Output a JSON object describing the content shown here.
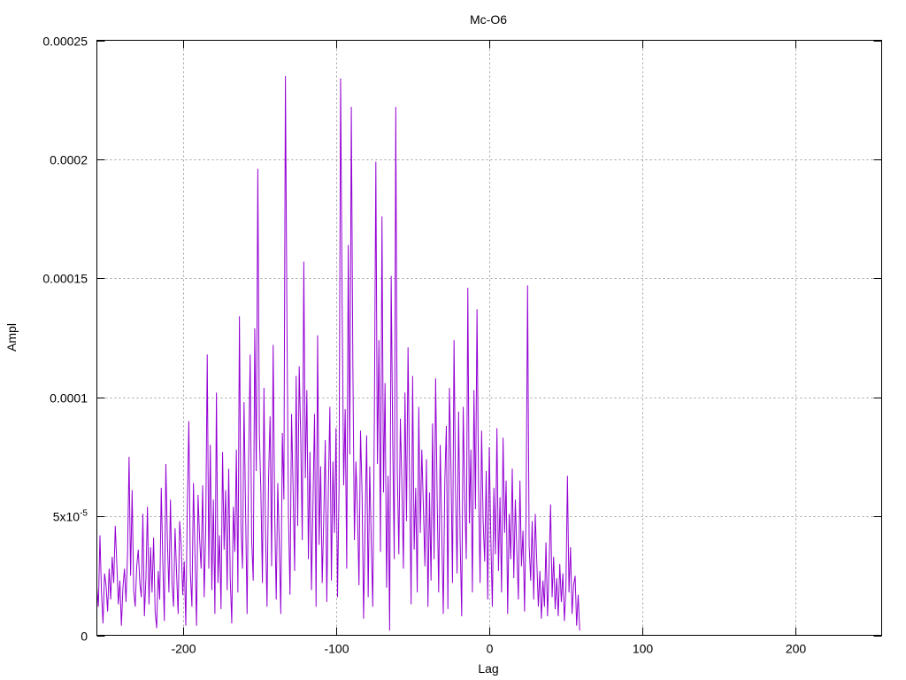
{
  "chart_data": {
    "type": "line",
    "title": "Mc-O6",
    "xlabel": "Lag",
    "ylabel": "Ampl",
    "xlim": [
      -256,
      256
    ],
    "ylim": [
      0,
      0.00025
    ],
    "grid": true,
    "x_ticks": [
      {
        "value": -200,
        "label": "-200"
      },
      {
        "value": -100,
        "label": "-100"
      },
      {
        "value": 0,
        "label": "0"
      },
      {
        "value": 100,
        "label": "100"
      },
      {
        "value": 200,
        "label": "200"
      }
    ],
    "y_ticks": [
      {
        "value": 0,
        "label": "0"
      },
      {
        "value": 5e-05,
        "label": "5x10",
        "sup": "-5"
      },
      {
        "value": 0.0001,
        "label": "0.0001"
      },
      {
        "value": 0.00015,
        "label": "0.00015"
      },
      {
        "value": 0.0002,
        "label": "0.0002"
      },
      {
        "value": 0.00025,
        "label": "0.00025"
      }
    ],
    "series": [
      {
        "color": "#9400d3",
        "x_start": -256,
        "x_step": 1,
        "values": [
          2e-05,
          1.2e-05,
          4.2e-05,
          1.8e-05,
          5e-06,
          2.6e-05,
          2.1e-05,
          1e-05,
          2.8e-05,
          1.5e-05,
          3.3e-05,
          2.2e-05,
          4.6e-05,
          3e-05,
          1.3e-05,
          2.3e-05,
          4e-06,
          2e-05,
          2.8e-05,
          1.4e-05,
          3.4e-05,
          7.5e-05,
          2.5e-05,
          6.1e-05,
          1.9e-05,
          1.2e-05,
          2.9e-05,
          3.6e-05,
          2.2e-05,
          1.6e-05,
          5.1e-05,
          8e-06,
          2.4e-05,
          5.4e-05,
          1.3e-05,
          3.7e-05,
          1.8e-05,
          4.1e-05,
          1e-05,
          3e-06,
          2.7e-05,
          1.5e-05,
          6.2e-05,
          3.1e-05,
          6e-06,
          7.2e-05,
          4e-05,
          1.8e-05,
          5.7e-05,
          2.2e-05,
          1.2e-05,
          4.5e-05,
          2.6e-05,
          9e-06,
          4.8e-05,
          3.8e-05,
          1.7e-05,
          3.1e-05,
          4e-06,
          5.4e-05,
          9e-05,
          2.6e-05,
          1.2e-05,
          6.4e-05,
          3.4e-05,
          4e-06,
          5.9e-05,
          4.1e-05,
          2.8e-05,
          6.3e-05,
          1.6e-05,
          4.4e-05,
          0.000118,
          2.8e-05,
          8e-05,
          1.9e-05,
          5.7e-05,
          9e-06,
          0.000102,
          2.2e-05,
          4.2e-05,
          1.1e-05,
          7.7e-05,
          3.6e-05,
          6.1e-05,
          1.9e-05,
          7e-05,
          2.4e-05,
          5e-06,
          5.4e-05,
          3.5e-05,
          7.8e-05,
          1.8e-05,
          0.000134,
          4.6e-05,
          2.8e-05,
          9.8e-05,
          5.3e-05,
          9e-06,
          7.3e-05,
          0.000118,
          4e-05,
          2.3e-05,
          0.000129,
          6.9e-05,
          0.000196,
          8.5e-05,
          6e-05,
          2.2e-05,
          0.000104,
          4.4e-05,
          1.2e-05,
          6.6e-05,
          9.2e-05,
          2.9e-05,
          0.000122,
          5.2e-05,
          1.5e-05,
          6.4e-05,
          3.8e-05,
          9e-06,
          8.5e-05,
          5.7e-05,
          0.000235,
          0.000131,
          5e-05,
          1.7e-05,
          9.3e-05,
          6.2e-05,
          2.7e-05,
          0.000109,
          4.6e-05,
          0.000113,
          8.3e-05,
          4e-05,
          0.000157,
          6.6e-05,
          0.000103,
          3.2e-05,
          7.7e-05,
          1.9e-05,
          5.6e-05,
          9.3e-05,
          1.2e-05,
          0.000126,
          3.8e-05,
          7.1e-05,
          2.2e-05,
          4.9e-05,
          8.2e-05,
          1.4e-05,
          6.1e-05,
          9.6e-05,
          2.3e-05,
          7.3e-05,
          4.3e-05,
          8.7e-05,
          1.6e-05,
          6.2e-05,
          0.000234,
          0.000141,
          6.3e-05,
          9.5e-05,
          2.8e-05,
          0.000164,
          7.6e-05,
          0.000222,
          0.000114,
          4e-05,
          7.3e-05,
          5.2e-05,
          2.1e-05,
          8.6e-05,
          6e-05,
          7e-06,
          4.7e-05,
          8.4e-05,
          1.6e-05,
          7.1e-05,
          3.9e-05,
          1.2e-05,
          8.8e-05,
          0.000199,
          7.2e-05,
          0.000124,
          3.5e-05,
          0.000176,
          6e-05,
          0.000106,
          2e-05,
          6.7e-05,
          2e-06,
          0.000151,
          8.2e-05,
          3.2e-05,
          0.000222,
          6.9e-05,
          3.4e-05,
          9.1e-05,
          6.3e-05,
          2.8e-05,
          0.000102,
          4.8e-05,
          0.000121,
          6.7e-05,
          1.3e-05,
          0.000109,
          3.6e-05,
          6.2e-05,
          1.8e-05,
          9.6e-05,
          4.3e-05,
          7.8e-05,
          5.4e-05,
          2.9e-05,
          7.4e-05,
          1.2e-05,
          6e-05,
          2.3e-05,
          8.9e-05,
          3.2e-05,
          0.000108,
          5.7e-05,
          1.8e-05,
          8e-05,
          4.3e-05,
          9e-06,
          6.5e-05,
          8.8e-05,
          1.1e-05,
          0.000104,
          7.1e-05,
          2.2e-05,
          0.000124,
          6.1e-05,
          2.6e-05,
          9.4e-05,
          4e-05,
          8e-06,
          9.6e-05,
          5.7e-05,
          3.2e-05,
          0.000146,
          4.7e-05,
          7.8e-05,
          1.8e-05,
          0.000103,
          5.3e-05,
          0.000137,
          6.4e-05,
          2.2e-05,
          8.6e-05,
          4.8e-05,
          3.1e-05,
          6.9e-05,
          1.5e-05,
          7.9e-05,
          4.1e-05,
          1.2e-05,
          6.2e-05,
          3.4e-05,
          8.7e-05,
          2.7e-05,
          5.8e-05,
          1.8e-05,
          8.3e-05,
          4.3e-05,
          6.5e-05,
          9e-06,
          5.1e-05,
          3.2e-05,
          7e-05,
          2.4e-05,
          5.7e-05,
          3.5e-05,
          1.5e-05,
          6.5e-05,
          2.9e-05,
          4.4e-05,
          1e-05,
          5.2e-05,
          0.000147,
          3.8e-05,
          2.3e-05,
          4.8e-05,
          1.5e-05,
          5.1e-05,
          3.1e-05,
          1.2e-05,
          2.7e-05,
          7e-06,
          2.3e-05,
          1.2e-05,
          3.9e-05,
          8e-06,
          2.8e-05,
          5.5e-05,
          1.6e-05,
          3.3e-05,
          1.1e-05,
          2.4e-05,
          8e-06,
          3e-05,
          1.4e-05,
          2.6e-05,
          6e-06,
          2e-05,
          6.7e-05,
          1.8e-05,
          3.7e-05,
          9e-06,
          2.1e-05,
          2.5e-05,
          4e-06,
          1.7e-05,
          2e-06
        ]
      }
    ]
  }
}
